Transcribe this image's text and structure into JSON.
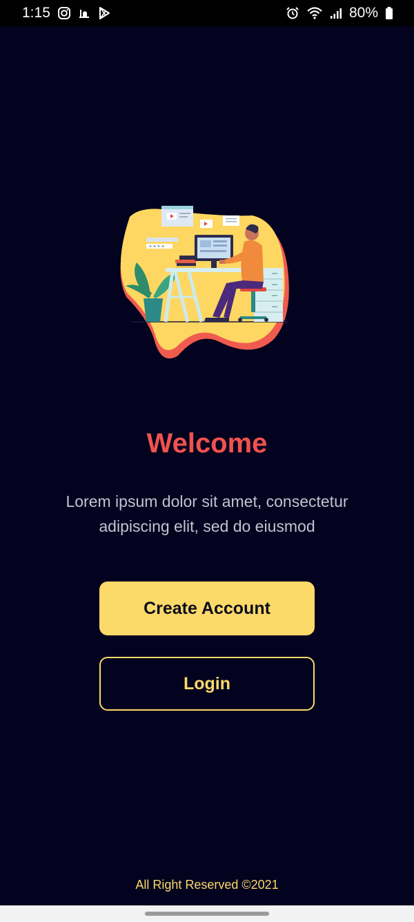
{
  "status_bar": {
    "time": "1:15",
    "battery": "80%",
    "left_icons": [
      "instagram-icon",
      "notification-icon",
      "play-store-icon"
    ],
    "right_icons": [
      "alarm-icon",
      "wifi-icon",
      "signal-icon",
      "battery-icon"
    ]
  },
  "welcome": {
    "title": "Welcome",
    "subtitle": "Lorem ipsum dolor sit amet, consectetur adipiscing elit, sed do eiusmod"
  },
  "buttons": {
    "create_account": "Create Account",
    "login": "Login"
  },
  "footer": {
    "text": "All Right Reserved ©2021"
  },
  "colors": {
    "background": "#03021f",
    "accent_yellow": "#fcda6a",
    "title_red": "#f0524f",
    "subtitle_gray": "#c4c3d0"
  },
  "illustration": {
    "name": "person-working-at-desk-illustration"
  }
}
